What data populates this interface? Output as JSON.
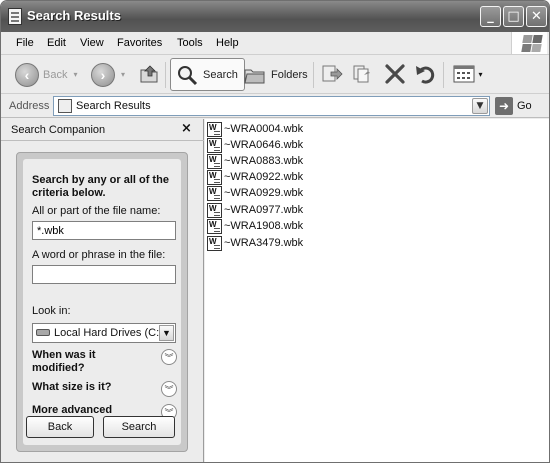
{
  "window": {
    "title": "Search Results"
  },
  "menu": [
    "File",
    "Edit",
    "View",
    "Favorites",
    "Tools",
    "Help"
  ],
  "toolbar": {
    "back": "Back",
    "search": "Search",
    "folders": "Folders"
  },
  "address": {
    "label": "Address",
    "value": "Search Results",
    "go": "Go"
  },
  "companion": {
    "title": "Search Companion",
    "lead": "Search by any or all of the criteria below.",
    "name_label": "All or part of the file name:",
    "name_value": "*.wbk",
    "phrase_label": "A word or phrase in the file:",
    "phrase_value": "",
    "lookin_label": "Look in:",
    "lookin_value": "Local Hard Drives (C:)",
    "when_label": "When was it modified?",
    "size_label": "What size is it?",
    "advanced_label": "More advanced options",
    "back_button": "Back",
    "search_button": "Search"
  },
  "results": [
    "~WRA0004.wbk",
    "~WRA0646.wbk",
    "~WRA0883.wbk",
    "~WRA0922.wbk",
    "~WRA0929.wbk",
    "~WRA0977.wbk",
    "~WRA1908.wbk",
    "~WRA3479.wbk"
  ]
}
